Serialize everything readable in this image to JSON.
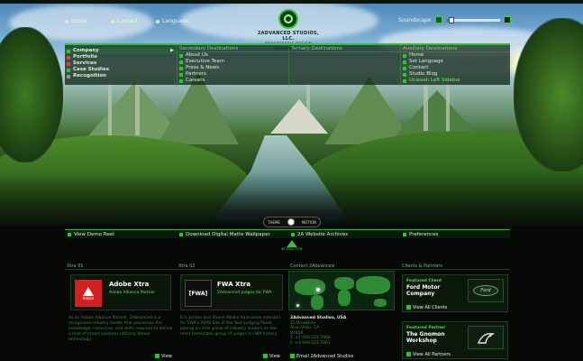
{
  "top_links": [
    {
      "label": "Home",
      "icon": "dot-icon"
    },
    {
      "label": "Contact",
      "icon": "dot-icon"
    },
    {
      "label": "Language",
      "icon": "dot-icon"
    }
  ],
  "logo": {
    "name": "2ADVANCED STUDIOS, LLC.",
    "tagline": "PROGRESSIVE DESIGN TECHNOLOGY"
  },
  "sound": {
    "label": "Soundscape",
    "level": 0.1
  },
  "nav": {
    "primary": [
      {
        "label": "Company",
        "color": "#33c133",
        "active": true
      },
      {
        "label": "Portfolio",
        "color": "#e04040"
      },
      {
        "label": "Services",
        "color": "#e04040"
      },
      {
        "label": "Case Studies",
        "color": "#33c133"
      },
      {
        "label": "Recognition",
        "color": "#8a958a"
      }
    ],
    "secondary": {
      "heading": "Secondary Destinations",
      "items": [
        "About Us",
        "Executive Team",
        "Press & News",
        "Partners",
        "Careers"
      ]
    },
    "tertiary": {
      "heading": "Tertiary Destinations"
    },
    "auxiliary": {
      "heading": "Auxiliary Destinations",
      "items": [
        "Home",
        "Set Language",
        "Contact",
        "Studio Blog",
        "Unleash Left Sidebar"
      ]
    }
  },
  "toggle": {
    "left": "THEME",
    "right": "MOTION"
  },
  "bars": [
    {
      "label": "View Demo Reel"
    },
    {
      "label": "Download Digital Matte Wallpaper"
    },
    {
      "label": "2A Website Archives"
    },
    {
      "label": "Preferences"
    }
  ],
  "emblem": {
    "text": "ATTRACTOR"
  },
  "sections": {
    "xtra1": "Xtra 01",
    "xtra2": "Xtra 02",
    "contact": "Contact 2Advanced",
    "clients": "Clients & Partners"
  },
  "adobe": {
    "title": "Adobe Xtra",
    "subtitle": "Adobe Alliance Partner",
    "logo_text": "Adobe",
    "body": "As an Adobe Alliance Partner, 2Advanced is a recognized industry leader that possesses the knowledge, resources, and skills required to deliver a host of broad solutions utilizing Adobe technology.",
    "view": "View"
  },
  "fwa": {
    "title": "FWA Xtra",
    "subtitle": "2Advanced Judges for FWA",
    "logo_text": "[FWA]",
    "body": "Eric Jordan and Shane Mielke have been selected for FWA's 2008 Site of the Year Judging Panel, joining an elite group of industry leaders as the most formidable group of judges in FWA history.",
    "view": "View"
  },
  "contact": {
    "company": "2Advanced Studios, USA",
    "lines": [
      "21 Brookline",
      "Aliso Viejo, CA",
      "92656",
      "T: +1.949.521.7000",
      "F: +1.949.521.7001"
    ],
    "email_label": "Email 2Advanced Studios"
  },
  "featured_client": {
    "label": "Featured Client",
    "name": "Ford Motor Company",
    "view": "View All Clients",
    "logo_text": "Ford"
  },
  "featured_partner": {
    "label": "Featured Partner",
    "name": "The Gnomon Workshop",
    "view": "View All Partners"
  },
  "colors": {
    "accent": "#33c133",
    "panel": "#0b160b"
  }
}
